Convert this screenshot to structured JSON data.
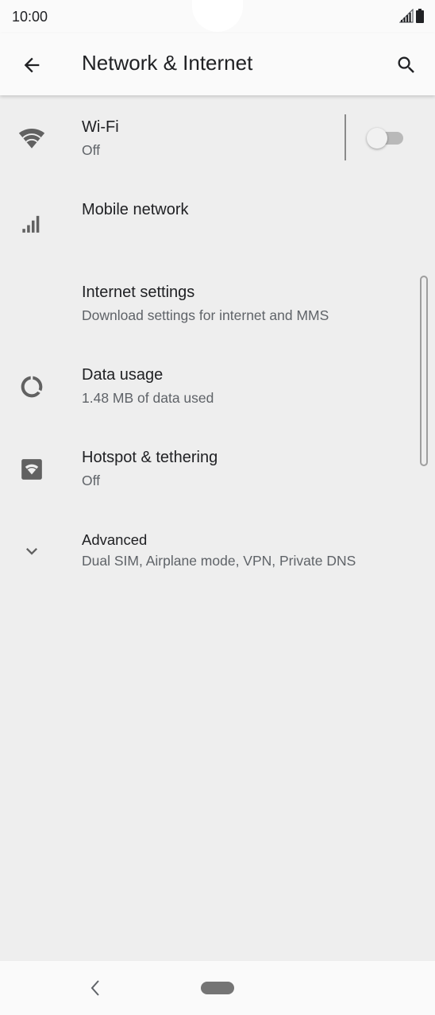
{
  "status_bar": {
    "time": "10:00",
    "icons": [
      "signal-icon",
      "battery-icon"
    ]
  },
  "app_bar": {
    "title": "Network & Internet",
    "back_icon": "arrow-back-icon",
    "search_icon": "search-icon"
  },
  "items": [
    {
      "id": "wifi",
      "icon": "wifi-icon",
      "title": "Wi-Fi",
      "summary": "Off",
      "toggle_on": false
    },
    {
      "id": "mobile-network",
      "icon": "cellular-signal-icon",
      "title": "Mobile network",
      "summary": ""
    },
    {
      "id": "internet-settings",
      "icon": "",
      "title": "Internet settings",
      "summary": "Download settings for internet and MMS"
    },
    {
      "id": "data-usage",
      "icon": "data-usage-icon",
      "title": "Data usage",
      "summary": "1.48 MB of data used"
    },
    {
      "id": "hotspot",
      "icon": "hotspot-icon",
      "title": "Hotspot & tethering",
      "summary": "Off"
    },
    {
      "id": "advanced",
      "icon": "chevron-down-icon",
      "title": "Advanced",
      "summary": "Dual SIM, Airplane mode, VPN, Private DNS"
    }
  ],
  "nav_bar": {
    "back_icon": "nav-back-icon",
    "home_icon": "home-pill-icon"
  },
  "colors": {
    "background": "#eeeeee",
    "bar_background": "#fafafa",
    "primary_text": "#202124",
    "secondary_text": "#5f6368",
    "icon": "#616161"
  }
}
